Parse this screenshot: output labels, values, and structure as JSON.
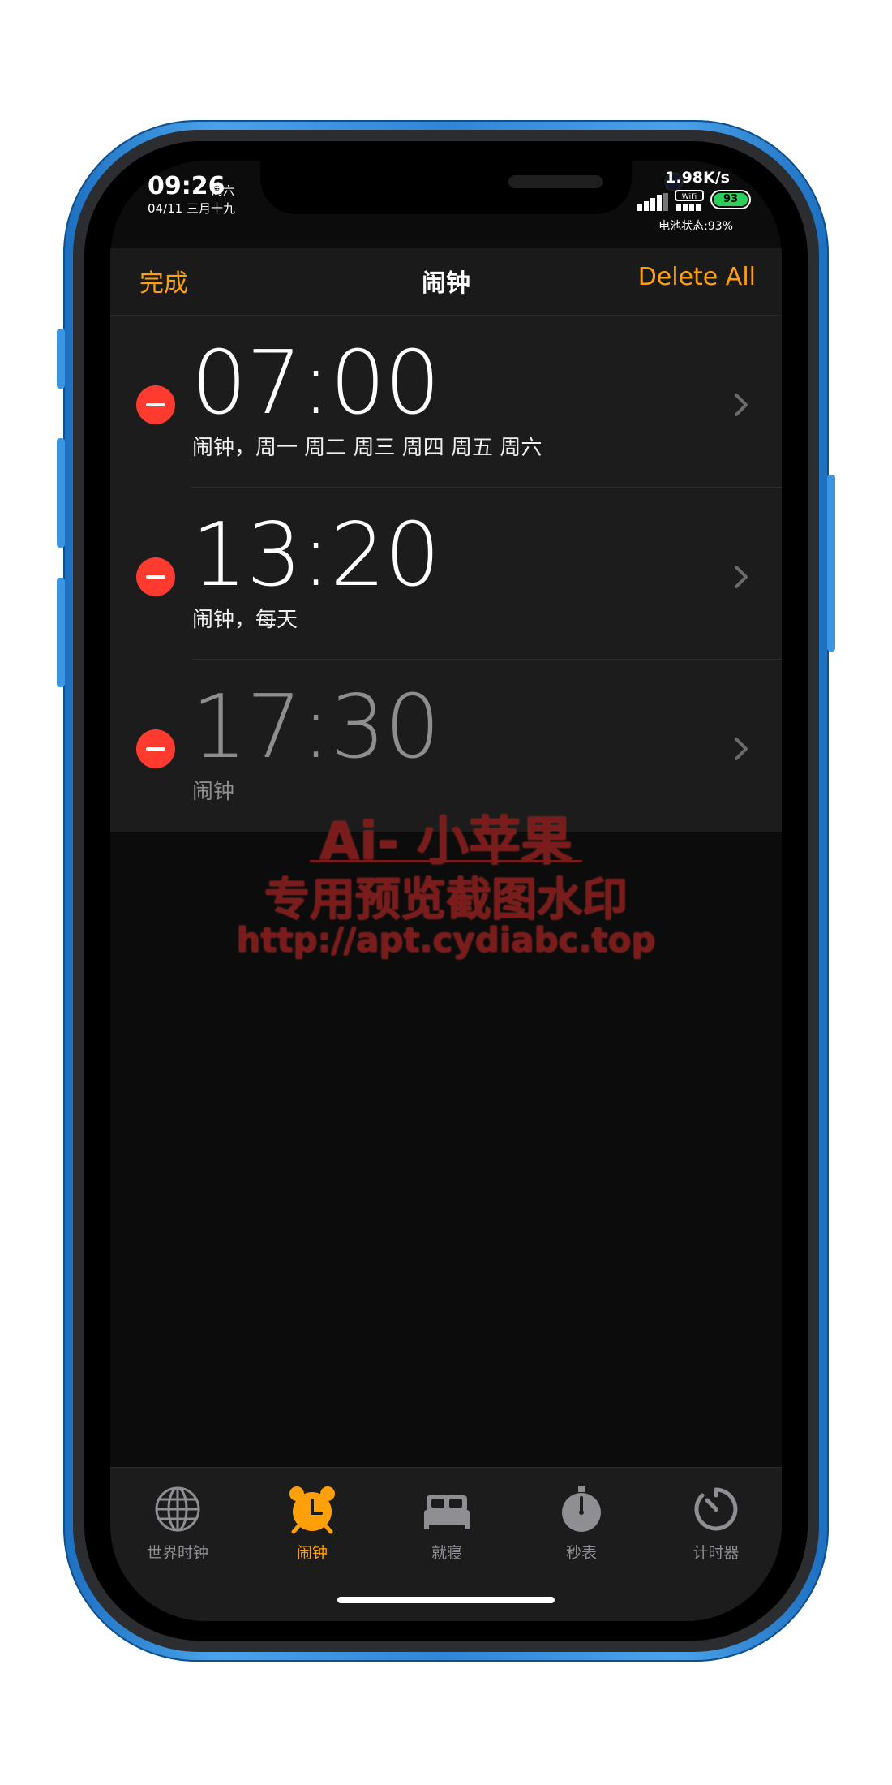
{
  "status": {
    "time": "09:26",
    "weekday": "周六",
    "date": "04/11 三月十九",
    "net_speed": "1.98K/s",
    "battery": "93",
    "battery_status": "电池状态:93%"
  },
  "nav": {
    "done": "完成",
    "title": "闹钟",
    "delete_all": "Delete All"
  },
  "alarms": [
    {
      "time": "07:00",
      "label": "闹钟，周一 周二 周三 周四 周五 周六",
      "enabled": true
    },
    {
      "time": "13:20",
      "label": "闹钟，每天",
      "enabled": true
    },
    {
      "time": "17:30",
      "label": "闹钟",
      "enabled": false
    }
  ],
  "watermark": {
    "title": "Ai- 小苹果",
    "subtitle": "专用预览截图水印",
    "url": "http://apt.cydiabc.top"
  },
  "tabs": [
    {
      "label": "世界时钟",
      "icon": "globe-icon"
    },
    {
      "label": "闹钟",
      "icon": "alarm-clock-icon",
      "active": true
    },
    {
      "label": "就寝",
      "icon": "bed-icon"
    },
    {
      "label": "秒表",
      "icon": "stopwatch-icon"
    },
    {
      "label": "计时器",
      "icon": "timer-icon"
    }
  ],
  "colors": {
    "accent": "#ff9f0a",
    "delete": "#ff3b30",
    "frame": "#2f86d6"
  }
}
